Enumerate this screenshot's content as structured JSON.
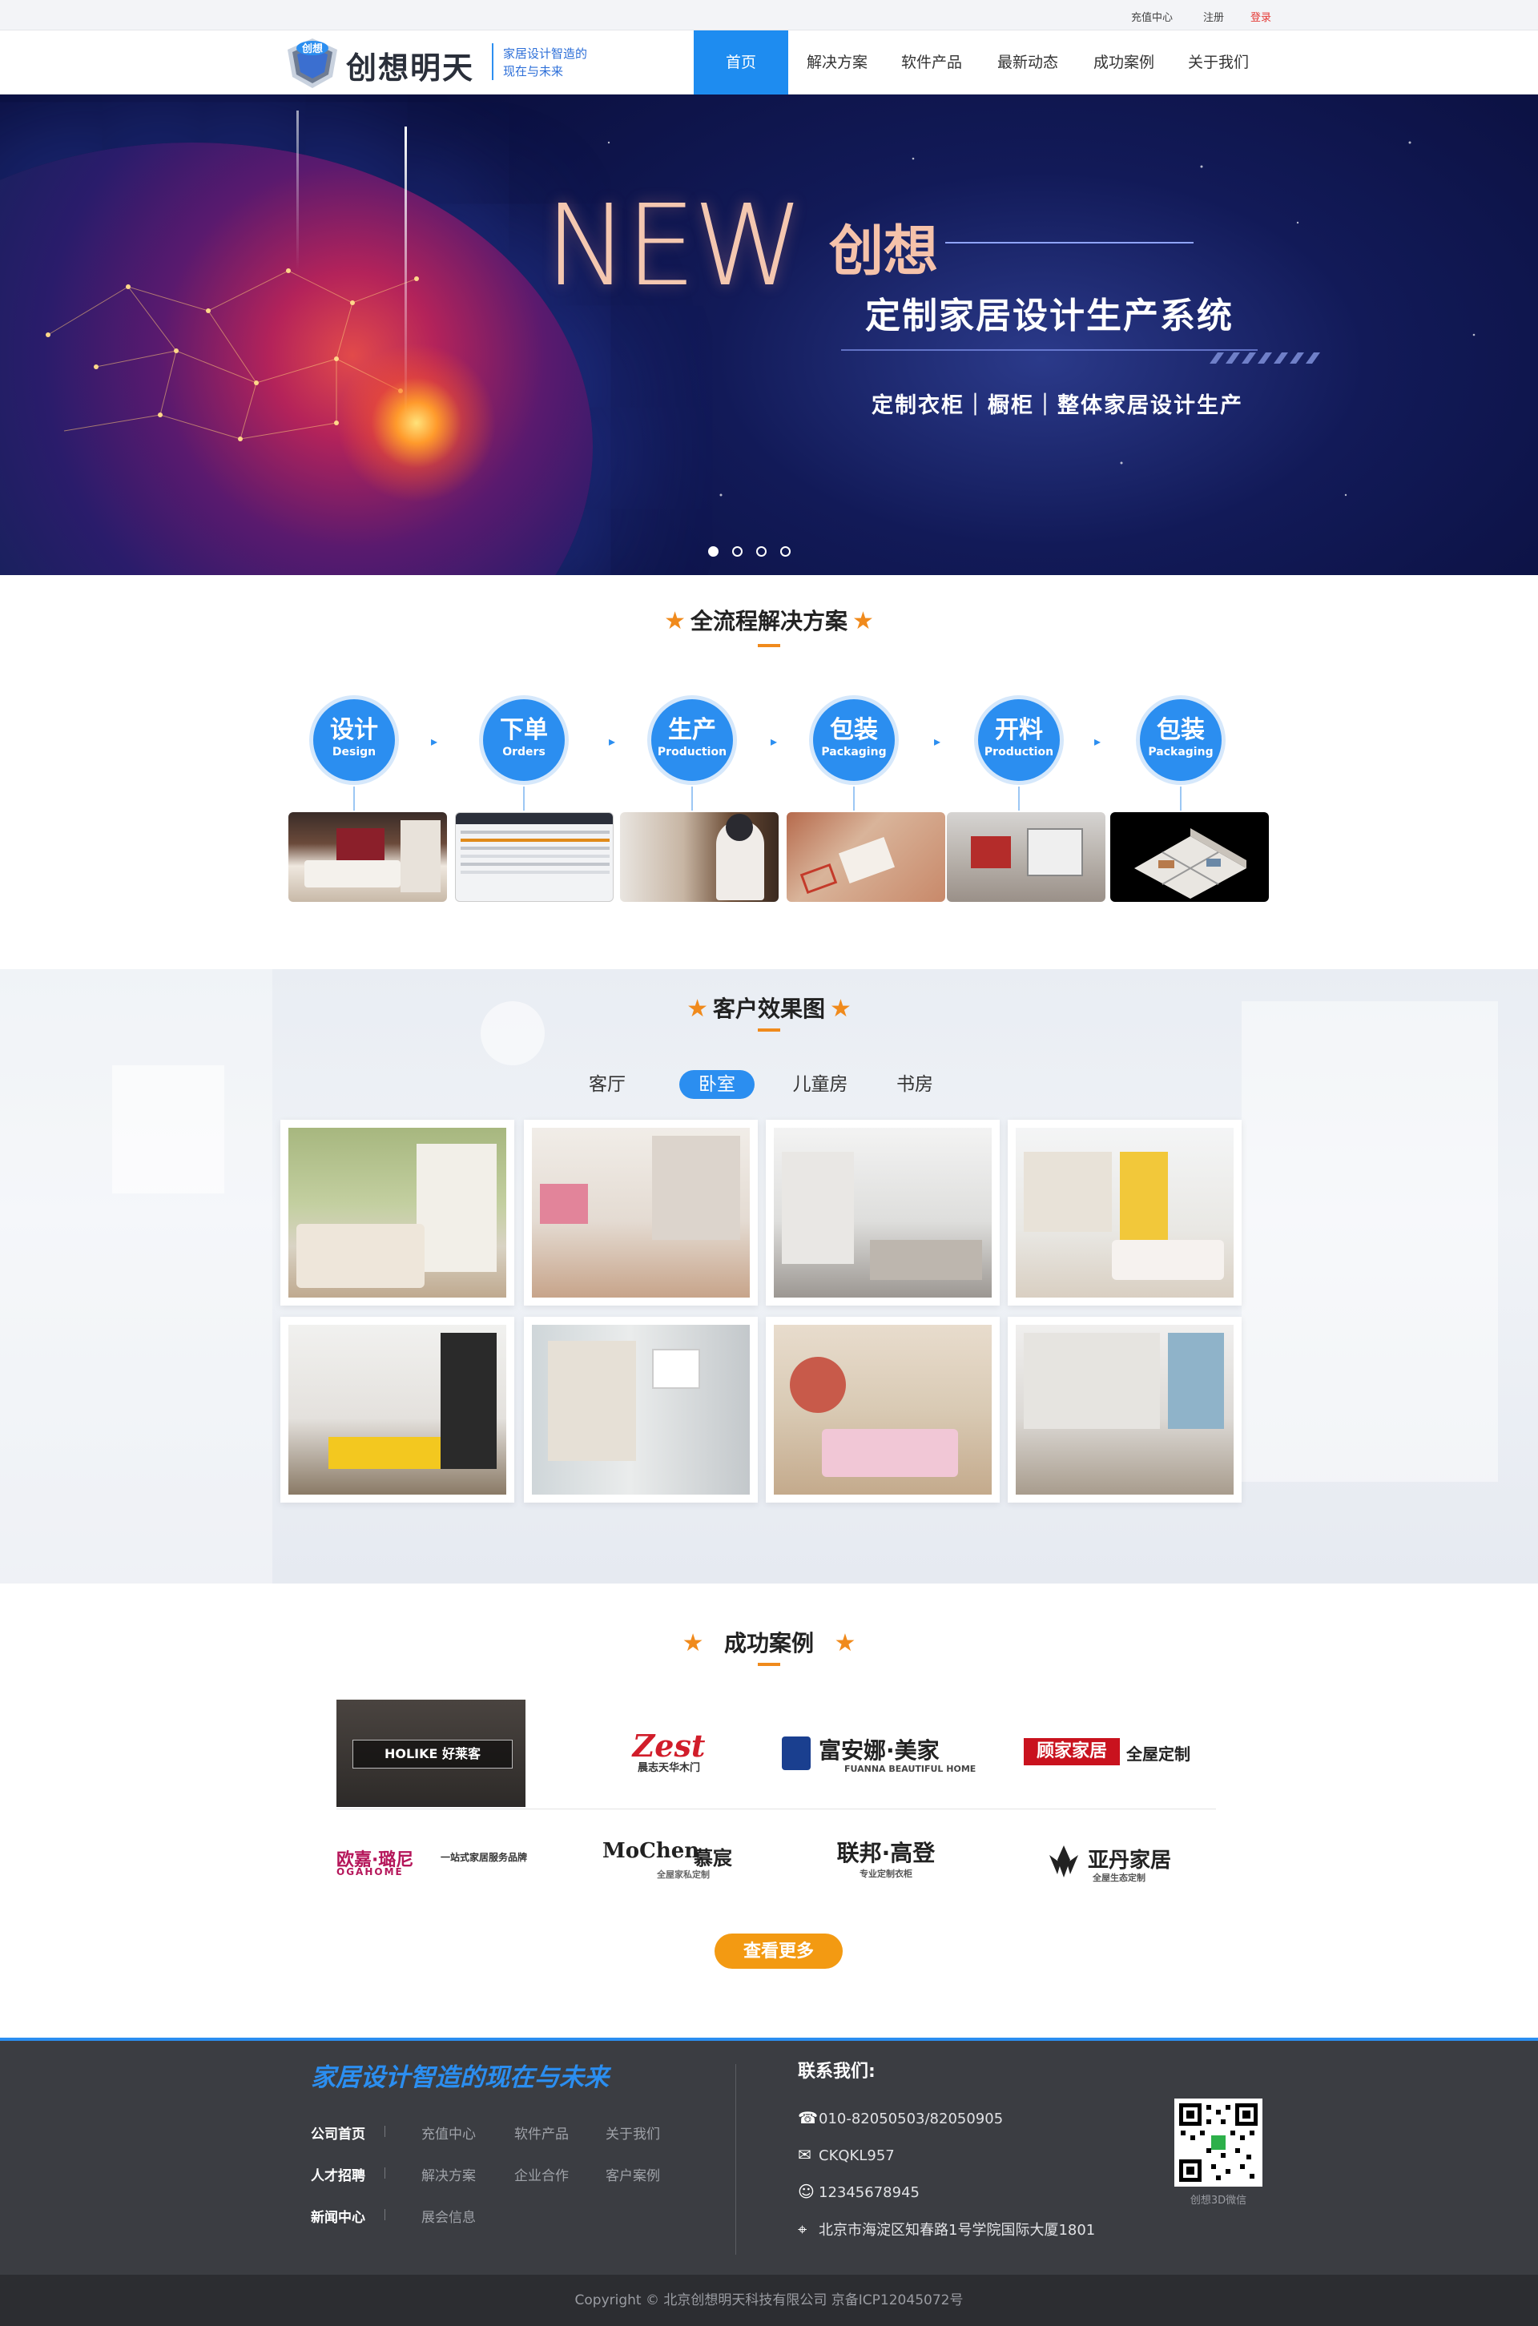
{
  "topbar": {
    "recharge": "充值中心",
    "register": "注册",
    "login": "登录"
  },
  "header": {
    "logo_badge": "创想",
    "logo_text": "创想明天",
    "slogan_line1": "家居设计智造的",
    "slogan_line2": "现在与未来",
    "nav": [
      "首页",
      "解决方案",
      "软件产品",
      "最新动态",
      "成功案例",
      "关于我们"
    ],
    "active_nav_index": 0
  },
  "banner": {
    "headline_en": "NEW",
    "headline_cn": "创想",
    "subtitle": "定制家居设计生产系统",
    "tagline": "定制衣柜｜橱柜｜整体家居设计生产",
    "slide_count": 4,
    "active_slide": 0
  },
  "solutions": {
    "title": "全流程解决方案",
    "steps": [
      {
        "cn": "设计",
        "en": "Design"
      },
      {
        "cn": "下单",
        "en": "Orders"
      },
      {
        "cn": "生产",
        "en": "Production"
      },
      {
        "cn": "包装",
        "en": "Packaging"
      },
      {
        "cn": "开料",
        "en": "Production"
      },
      {
        "cn": "包装",
        "en": "Packaging"
      }
    ]
  },
  "effects": {
    "title": "客户效果图",
    "tabs": [
      "客厅",
      "卧室",
      "儿童房",
      "书房"
    ],
    "active_tab": 1
  },
  "cases": {
    "title": "成功案例",
    "logos_row1": [
      "HOLIKE 好莱客",
      "Zest 晨志天华木门",
      "富安娜·美家",
      "顾家家居 全屋定制"
    ],
    "zest_en": "Zest",
    "zest_cn": "晨志天华木门",
    "fuanna_cn": "富安娜·美家",
    "fuanna_en": "FUANNA BEAUTIFUL HOME",
    "kuka_cn": "顾家家居",
    "kuka_sub": "全屋定制",
    "holike_text": "HOLIKE 好莱客",
    "logos_row2": [
      "欧嘉·璐尼",
      "MoChen 慕宸",
      "联邦·高登",
      "亚丹家居"
    ],
    "oujia_cn": "欧嘉·璐尼",
    "oujia_en": "OGAHOME",
    "oujia_note": "一站式家居服务品牌",
    "mochen_en": "MoChen",
    "mochen_cn": "慕宸",
    "mochen_sub": "全屋家私定制",
    "lianbang": "联邦·高登",
    "lianbang_sub": "专业定制衣柜",
    "yadan": "亚丹家居",
    "yadan_sub": "全屋生态定制",
    "more_button": "查看更多"
  },
  "footer": {
    "slogan": "家居设计智造的现在与未来",
    "links": [
      [
        "公司首页",
        "充值中心",
        "软件产品",
        "关于我们"
      ],
      [
        "人才招聘",
        "解决方案",
        "企业合作",
        "客户案例"
      ],
      [
        "新闻中心",
        "展会信息"
      ]
    ],
    "contact_title": "联系我们:",
    "phone": "010-82050503/82050905",
    "wechat": "CKQKL957",
    "qq": "12345678945",
    "address": "北京市海淀区知春路1号学院国际大厦1801",
    "qr_caption": "创想3D微信",
    "copyright": "Copyright © 北京创想明天科技有限公司  京备ICP12045072号"
  },
  "colors": {
    "accent": "#2b8ef0",
    "orange": "#f39a12",
    "footer_bg": "#3b3d42",
    "banner_bg": "#121a58"
  }
}
